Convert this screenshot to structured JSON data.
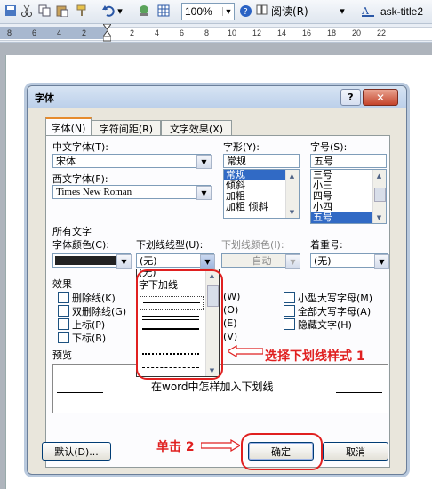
{
  "toolbar": {
    "zoom": "100%",
    "read_label": "阅读(R)",
    "doc_title": "ask-title2"
  },
  "ruler": {
    "numbers": [
      "8",
      "6",
      "4",
      "2",
      "2",
      "4",
      "6",
      "8",
      "10",
      "12",
      "14",
      "16",
      "18",
      "20",
      "22"
    ]
  },
  "dialog": {
    "title": "字体",
    "help": "?",
    "tabs": [
      "字体(N)",
      "字符间距(R)",
      "文字效果(X)"
    ],
    "cn_font_label": "中文字体(T):",
    "cn_font_value": "宋体",
    "west_font_label": "西文字体(F):",
    "west_font_value": "Times New Roman",
    "style_label": "字形(Y):",
    "style_value": "常规",
    "style_items": [
      "常规",
      "倾斜",
      "加粗",
      "加粗 倾斜"
    ],
    "size_label": "字号(S):",
    "size_value": "五号",
    "size_items": [
      "三号",
      "小三",
      "四号",
      "小四",
      "五号"
    ],
    "all_text_label": "所有文字",
    "color_label": "字体颜色(C):",
    "underline_type_label": "下划线线型(U):",
    "underline_type_value": "(无)",
    "underline_color_label": "下划线颜色(I):",
    "underline_color_value": "自动",
    "emphasis_label": "着重号:",
    "emphasis_value": "(无)",
    "underline_dropdown_items": [
      "(无)",
      "字下加线"
    ],
    "effects_label": "效果",
    "effects_left": [
      "删除线(K)",
      "双删除线(G)",
      "上标(P)",
      "下标(B)"
    ],
    "effects_mid_hints": [
      "(W)",
      "(O)",
      "(E)",
      "(V)"
    ],
    "effects_right": [
      "小型大写字母(M)",
      "全部大写字母(A)",
      "隐藏文字(H)"
    ],
    "preview_label": "预览",
    "preview_text": "在word中怎样加入下划线",
    "default_button": "默认(D)...",
    "ok_button": "确定",
    "cancel_button": "取消"
  },
  "annotations": {
    "select_style": "选择下划线样式 1",
    "click": "单击 2"
  },
  "colors": {
    "annotation_red": "#e02020",
    "selection_blue": "#316ac5"
  }
}
